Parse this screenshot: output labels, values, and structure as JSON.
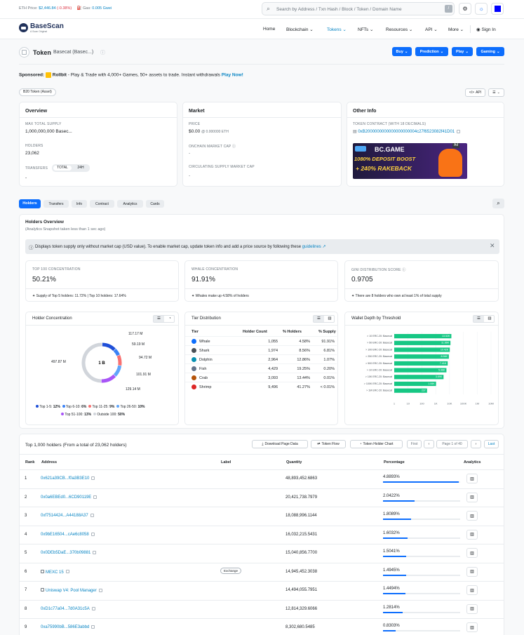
{
  "topbar": {
    "eth_price_label": "ETH Price:",
    "eth_price": "$2,446.84",
    "eth_change": "(-0.38%)",
    "gas_label": "Gas:",
    "gas": "0.005 Gwei",
    "search_placeholder": "Search by Address / Txn Hash / Block / Token / Domain Name",
    "search_key": "/"
  },
  "brand": {
    "name": "BaseScan",
    "tagline": "A Scan Original"
  },
  "nav": {
    "items": [
      "Home",
      "Blockchain",
      "Tokens",
      "NFTs",
      "Resources",
      "API",
      "More"
    ],
    "sign_in": "Sign In"
  },
  "token": {
    "label": "Token",
    "name": "Basecat (Basec...)",
    "buttons": [
      "Buy",
      "Prediction",
      "Play",
      "Gaming"
    ]
  },
  "sponsored": {
    "label": "Sponsored:",
    "brand": "Rollbit",
    "text": "- Play & Trade with 4,000+ Games, 50+ assets to trade. Instant withdrawals",
    "cta": "Play Now!"
  },
  "badge": "B20 Token (Asset)",
  "api_label": "API",
  "overview": {
    "title": "Overview",
    "max_supply_label": "MAX TOTAL SUPPLY",
    "max_supply": "1,000,000,000 Basec...",
    "holders_label": "HOLDERS",
    "holders": "23,062",
    "transfers_label": "TRANSFERS",
    "transfers_tabs": [
      "TOTAL",
      "24H"
    ],
    "transfers": "-"
  },
  "market": {
    "title": "Market",
    "price_label": "PRICE",
    "price": "$0.00",
    "price_eth": "@ 0.000000 ETH",
    "onchain_label": "ONCHAIN MARKET CAP",
    "onchain": "-",
    "circ_label": "CIRCULATING SUPPLY MARKET CAP",
    "circ": "-"
  },
  "other": {
    "title": "Other Info",
    "contract_label": "TOKEN CONTRACT (WITH 18 DECIMALS)",
    "contract": "0xB2000000000000000000004c27f6523082f41D01",
    "ad_badge": "Ad",
    "ad_brand": "BC.GAME",
    "ad_line1": "1080% DEPOSIT BOOST",
    "ad_line2": "+ 240% RAKEBACK"
  },
  "tabs": [
    "Holders",
    "Transfers",
    "Info",
    "Contract",
    "Analytics",
    "Cards"
  ],
  "holders_overview": {
    "title": "Holders Overview",
    "subtitle": "(Analytics Snapshot taken less than 1 sec ago)",
    "notice": "Displays token supply only without market cap (USD value). To enable market cap, update token info and add a price source by following these",
    "notice_link": "guidelines"
  },
  "stats": [
    {
      "label": "TOP 100 CONCENTRATION",
      "value": "50.21%",
      "foot": "Supply of Top 5 holders: 11.72% | Top 10 holders: 17.64%"
    },
    {
      "label": "WHALE CONCENTRATION",
      "value": "91.91%",
      "foot": "Whales make up 4.58% of holders"
    },
    {
      "label": "GINI DISTRIBUTION SCORE",
      "value": "0.9705",
      "foot": "There are 8 holders who own at least 1% of total supply"
    }
  ],
  "concentration": {
    "title": "Holder Concentration",
    "center": "1 B",
    "labels": [
      "117.17 M",
      "59.19 M",
      "94.72 M",
      "101.91 M",
      "129.14 M",
      "497.87 M"
    ],
    "legend": [
      {
        "name": "Top 1-5:",
        "value": "12%",
        "color": "#1f4fd8"
      },
      {
        "name": "Top 6-10:",
        "value": "6%",
        "color": "#3b82f6"
      },
      {
        "name": "Top 11-25:",
        "value": "9%",
        "color": "#f87171"
      },
      {
        "name": "Top 26-50:",
        "value": "10%",
        "color": "#60a5fa"
      },
      {
        "name": "Top 51-100:",
        "value": "13%",
        "color": "#a855f7"
      },
      {
        "name": "Outside 100:",
        "value": "50%",
        "color": "#d1d5db"
      }
    ],
    "segments": [
      12,
      6,
      9,
      10,
      13,
      50
    ]
  },
  "tier": {
    "title": "Tier Distribution",
    "headers": [
      "Tier",
      "Holder Count",
      "% Holders",
      "% Supply"
    ],
    "rows": [
      [
        "Whale",
        "1,055",
        "4.58%",
        "91.91%"
      ],
      [
        "Shark",
        "1,974",
        "8.56%",
        "6.81%"
      ],
      [
        "Dolphin",
        "2,964",
        "12.86%",
        "1.07%"
      ],
      [
        "Fish",
        "4,429",
        "19.25%",
        "0.20%"
      ],
      [
        "Crab",
        "3,093",
        "13.44%",
        "0.01%"
      ],
      [
        "Shrimp",
        "9,496",
        "41.27%",
        "< 0.01%"
      ]
    ]
  },
  "chart_data": {
    "type": "bar",
    "title": "Wallet Depth by Threshold",
    "categories": [
      "> 10 ERC-20: Basecat",
      "> 50 ERC-20: Basecat",
      "> 100 ERC-20: Basecat",
      "> 250 ERC-20: Basecat",
      "> 500 ERC-20: Basecat",
      "> 1K ERC-20: Basecat",
      "> 10K ERC-20: Basecat",
      "> 100K ERC-20: Basecat",
      "> 1M ERC-20: Basecat"
    ],
    "values": [
      13520,
      11660,
      10420,
      8940,
      7410,
      5960,
      3690,
      1060,
      237
    ],
    "value_labels": [
      "13.52K",
      "11.66K",
      "10.42K",
      "8.94K",
      "7.41K",
      "5.96K",
      "3.69K",
      "1.06K",
      "237"
    ],
    "xticks": [
      "1",
      "10",
      "100",
      "1K",
      "10K",
      "100K",
      "1M",
      "10M"
    ],
    "xscale": "log"
  },
  "top_holders": {
    "title": "Top 1,000 holders (From a total of 23,062 holders)",
    "buttons": [
      "Download Page Data",
      "Token Flow",
      "Token Holder Chart"
    ],
    "first": "First",
    "page": "Page 1 of 40",
    "last": "Last",
    "headers": [
      "Rank",
      "Address",
      "Label",
      "Quantity",
      "Percentage",
      "Analytics"
    ],
    "rows": [
      {
        "rank": "1",
        "address": "0x621a39CB...f0a3B3E10",
        "label": "",
        "qty": "48,893,452.6863",
        "pct": "4.8893%",
        "frac": 0.04889
      },
      {
        "rank": "2",
        "address": "0x0a6EBEd0...6CD90119E",
        "label": "",
        "qty": "20,421,738.7979",
        "pct": "2.0422%",
        "frac": 0.02042
      },
      {
        "rank": "3",
        "address": "0xf7514424...A44188A37",
        "label": "",
        "qty": "18,088,996.1144",
        "pct": "1.8089%",
        "frac": 0.01809
      },
      {
        "rank": "4",
        "address": "0x9bE16504...cAe6c8058",
        "label": "",
        "qty": "16,032,215.5431",
        "pct": "1.6032%",
        "frac": 0.01603
      },
      {
        "rank": "5",
        "address": "0x0DEb5DaE...370b09881",
        "label": "",
        "qty": "15,040,856.7700",
        "pct": "1.5041%",
        "frac": 0.01504
      },
      {
        "rank": "6",
        "address": "MEXC 15",
        "label": "Exchange",
        "qty": "14,945,452.3038",
        "pct": "1.4945%",
        "frac": 0.01495
      },
      {
        "rank": "7",
        "address": "Uniswap V4: Pool Manager",
        "label": "",
        "qty": "14,494,055.7951",
        "pct": "1.4494%",
        "frac": 0.01449
      },
      {
        "rank": "8",
        "address": "0xD1c77a04...7d0A31c5A",
        "label": "",
        "qty": "12,814,329.6066",
        "pct": "1.2814%",
        "frac": 0.01281
      },
      {
        "rank": "9",
        "address": "0xa75990bB...586E3abbd",
        "label": "",
        "qty": "8,302,680.5485",
        "pct": "0.8303%",
        "frac": 0.0083
      }
    ]
  }
}
